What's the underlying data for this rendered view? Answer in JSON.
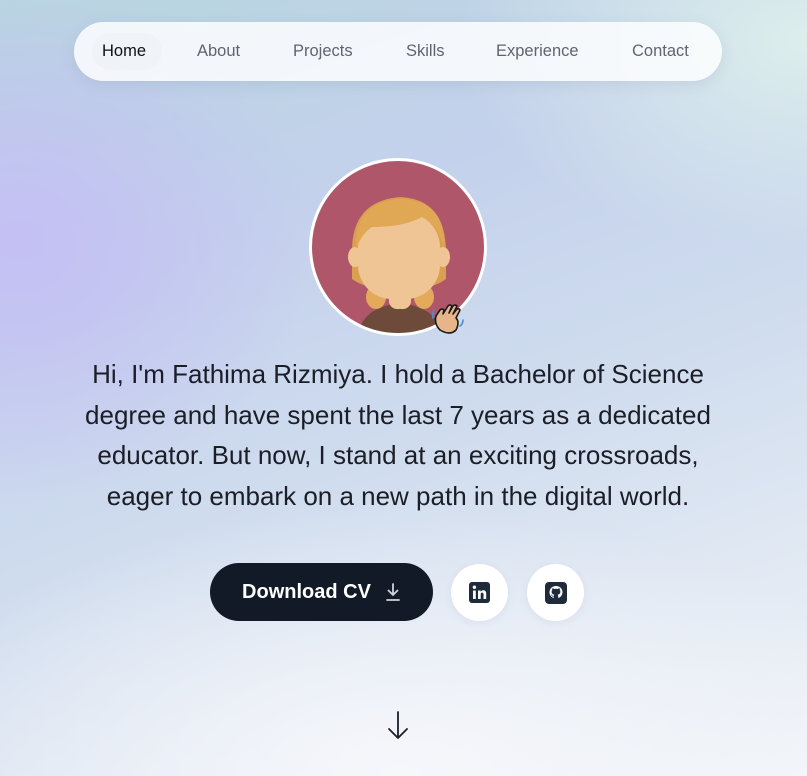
{
  "nav": {
    "items": [
      {
        "label": "Home"
      },
      {
        "label": "About"
      },
      {
        "label": "Projects"
      },
      {
        "label": "Skills"
      },
      {
        "label": "Experience"
      },
      {
        "label": "Contact"
      }
    ],
    "active": "Home"
  },
  "hero": {
    "avatar_icon": "female-avatar-illustration",
    "wave_icon": "waving-hand-icon",
    "intro_lines": [
      "Hi, I'm Fathima Rizmiya. I hold a Bachelor of Science",
      "degree and have spent the last 7 years as a dedicated",
      "educator. But now, I stand at an exciting crossroads,",
      "eager to embark on a new path in the digital world."
    ]
  },
  "actions": {
    "download_label": "Download CV",
    "download_icon": "download-icon",
    "linkedin_icon": "linkedin-icon",
    "github_icon": "github-icon"
  },
  "scroll": {
    "icon": "arrow-down-icon"
  },
  "colors": {
    "button_dark": "#131a27",
    "avatar_bg": "#b0566b",
    "text": "#1b1e27",
    "nav_inactive": "#5f6470"
  }
}
